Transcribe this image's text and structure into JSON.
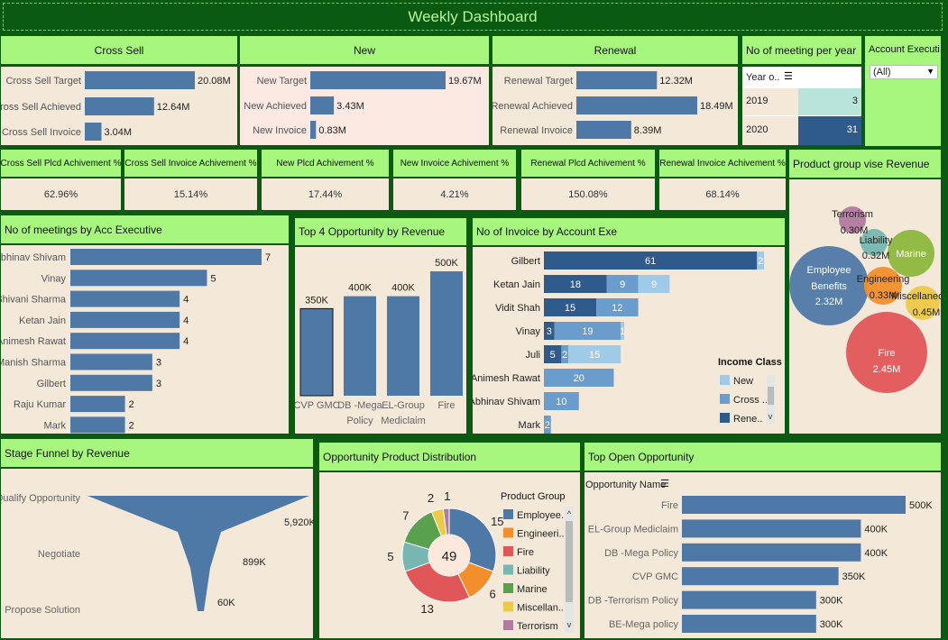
{
  "title": "Weekly Dashboard",
  "cross_sell": {
    "header": "Cross Sell",
    "rows": [
      {
        "label": "Cross Sell Target",
        "value": 20.08,
        "text": "20.08M"
      },
      {
        "label": "Cross Sell Achieved",
        "value": 12.64,
        "text": "12.64M"
      },
      {
        "label": "Cross Sell Invoice",
        "value": 3.04,
        "text": "3.04M"
      }
    ]
  },
  "new": {
    "header": "New",
    "rows": [
      {
        "label": "New Target",
        "value": 19.67,
        "text": "19.67M"
      },
      {
        "label": "New Achieved",
        "value": 3.43,
        "text": "3.43M"
      },
      {
        "label": "New Invoice",
        "value": 0.83,
        "text": "0.83M"
      }
    ]
  },
  "renewal": {
    "header": "Renewal",
    "rows": [
      {
        "label": "Renewal Target",
        "value": 12.32,
        "text": "12.32M"
      },
      {
        "label": "Renewal Achieved",
        "value": 18.49,
        "text": "18.49M"
      },
      {
        "label": "Renewal Invoice",
        "value": 8.39,
        "text": "8.39M"
      }
    ]
  },
  "meetings_per_year": {
    "header": "No of meeting per year",
    "col_header": "Year o..",
    "rows": [
      {
        "year": "2019",
        "value": "3"
      },
      {
        "year": "2020",
        "value": "31"
      }
    ]
  },
  "account_exec_filter": {
    "header": "Account Executi..",
    "selected": "(All)"
  },
  "kpis": [
    {
      "label": "Cross Sell Plcd Achivement %",
      "value": "62.96%"
    },
    {
      "label": "Cross Sell Invoice Achivement %",
      "value": "15.14%"
    },
    {
      "label": "New Plcd Achivement %",
      "value": "17.44%"
    },
    {
      "label": "New Invoice Achivement %",
      "value": "4.21%"
    },
    {
      "label": "Renewal Plcd Achivement %",
      "value": "150.08%"
    },
    {
      "label": "Renewal Invoice Achivement %",
      "value": "68.14%"
    }
  ],
  "meetings_by_exec": {
    "header": "No of meetings by Acc Executive",
    "rows": [
      {
        "name": "Abhinav Shivam",
        "value": 7
      },
      {
        "name": "Vinay",
        "value": 5
      },
      {
        "name": "Shivani Sharma",
        "value": 4
      },
      {
        "name": "Ketan Jain",
        "value": 4
      },
      {
        "name": "Animesh Rawat",
        "value": 4
      },
      {
        "name": "Manish Sharma",
        "value": 3
      },
      {
        "name": "Gilbert",
        "value": 3
      },
      {
        "name": "Raju Kumar",
        "value": 2
      },
      {
        "name": "Mark",
        "value": 2
      }
    ]
  },
  "top4": {
    "header": "Top 4 Opportunity by Revenue",
    "bars": [
      {
        "name": "CVP GMC",
        "value": 350,
        "text": "350K"
      },
      {
        "name": "DB -Mega Policy",
        "value": 400,
        "text": "400K"
      },
      {
        "name": "EL-Group Mediclaim",
        "value": 400,
        "text": "400K"
      },
      {
        "name": "Fire",
        "value": 500,
        "text": "500K"
      }
    ]
  },
  "invoice_by_exec": {
    "header": "No of Invoice by Account Exe",
    "legend_title": "Income Class (..",
    "legend": [
      {
        "name": "New",
        "color": "#a0cbe8"
      },
      {
        "name": "Cross ..",
        "color": "#6a9ccc"
      },
      {
        "name": "Rene..",
        "color": "#2e5b8c"
      }
    ],
    "rows": [
      {
        "name": "Gilbert",
        "segs": [
          {
            "cls": 2,
            "v": 61,
            "t": "61"
          },
          {
            "cls": 0,
            "v": 2,
            "t": "2"
          }
        ]
      },
      {
        "name": "Ketan Jain",
        "segs": [
          {
            "cls": 2,
            "v": 18,
            "t": "18"
          },
          {
            "cls": 1,
            "v": 9,
            "t": "9"
          },
          {
            "cls": 0,
            "v": 9,
            "t": "9"
          }
        ]
      },
      {
        "name": "Vidit Shah",
        "segs": [
          {
            "cls": 2,
            "v": 15,
            "t": "15"
          },
          {
            "cls": 1,
            "v": 12,
            "t": "12"
          }
        ]
      },
      {
        "name": "Vinay",
        "segs": [
          {
            "cls": 2,
            "v": 3,
            "t": "3"
          },
          {
            "cls": 1,
            "v": 19,
            "t": "19"
          },
          {
            "cls": 0,
            "v": 1,
            "t": "1"
          }
        ]
      },
      {
        "name": "Juli",
        "segs": [
          {
            "cls": 2,
            "v": 5,
            "t": "5"
          },
          {
            "cls": 1,
            "v": 2,
            "t": "2"
          },
          {
            "cls": 0,
            "v": 15,
            "t": "15"
          }
        ]
      },
      {
        "name": "Animesh Rawat",
        "segs": [
          {
            "cls": 1,
            "v": 20,
            "t": "20"
          }
        ]
      },
      {
        "name": "Abhinav Shivam",
        "segs": [
          {
            "cls": 1,
            "v": 10,
            "t": "10"
          }
        ]
      },
      {
        "name": "Mark",
        "segs": [
          {
            "cls": 1,
            "v": 2,
            "t": "2"
          }
        ]
      }
    ]
  },
  "product_revenue": {
    "header": "Product group vise Revenue",
    "bubbles": [
      {
        "name": "Terrorism",
        "text": "0.30M",
        "color": "#b07aa1"
      },
      {
        "name": "Liability",
        "text": "0.32M",
        "color": "#76b7b2"
      },
      {
        "name": "Marine",
        "text": "",
        "color": "#8cb83e"
      },
      {
        "name": "Employee Benefits",
        "text": "2.32M",
        "color": "#4e79a7"
      },
      {
        "name": "Engineering",
        "text": "0.33M",
        "color": "#f28e2b"
      },
      {
        "name": "Miscellaneous",
        "text": "0.45M",
        "color": "#edc948"
      },
      {
        "name": "Fire",
        "text": "2.45M",
        "color": "#e15759"
      }
    ]
  },
  "funnel": {
    "header": "Stage Funnel by Revenue",
    "stages": [
      {
        "name": "Qualify Opportunity",
        "text": "5,920K",
        "value": 5920
      },
      {
        "name": "Negotiate",
        "text": "899K",
        "value": 899
      },
      {
        "name": "Propose Solution",
        "text": "60K",
        "value": 60
      }
    ]
  },
  "product_dist": {
    "header": "Opportunity Product Distribution",
    "legend_title": "Product Group",
    "total": "49",
    "slices": [
      {
        "name": "Employee..",
        "value": 15,
        "color": "#4e79a7"
      },
      {
        "name": "Engineeri..",
        "value": 6,
        "color": "#f28e2b"
      },
      {
        "name": "Fire",
        "value": 13,
        "color": "#e15759"
      },
      {
        "name": "Liability",
        "value": 5,
        "color": "#76b7b2"
      },
      {
        "name": "Marine",
        "value": 7,
        "color": "#59a14f"
      },
      {
        "name": "Miscellan..",
        "value": 2,
        "color": "#edc948"
      },
      {
        "name": "Terrorism",
        "value": 1,
        "color": "#b07aa1"
      }
    ]
  },
  "open_opp": {
    "header": "Top Open Opportunity",
    "col_header": "Opportunity Name",
    "rows": [
      {
        "name": "Fire",
        "value": 500,
        "text": "500K"
      },
      {
        "name": "EL-Group Mediclaim",
        "value": 400,
        "text": "400K"
      },
      {
        "name": "DB -Mega Policy",
        "value": 400,
        "text": "400K"
      },
      {
        "name": "CVP GMC",
        "value": 350,
        "text": "350K"
      },
      {
        "name": "DB -Terrorism Policy",
        "value": 300,
        "text": "300K"
      },
      {
        "name": "BE-Mega policy",
        "value": 300,
        "text": "300K"
      }
    ]
  }
}
